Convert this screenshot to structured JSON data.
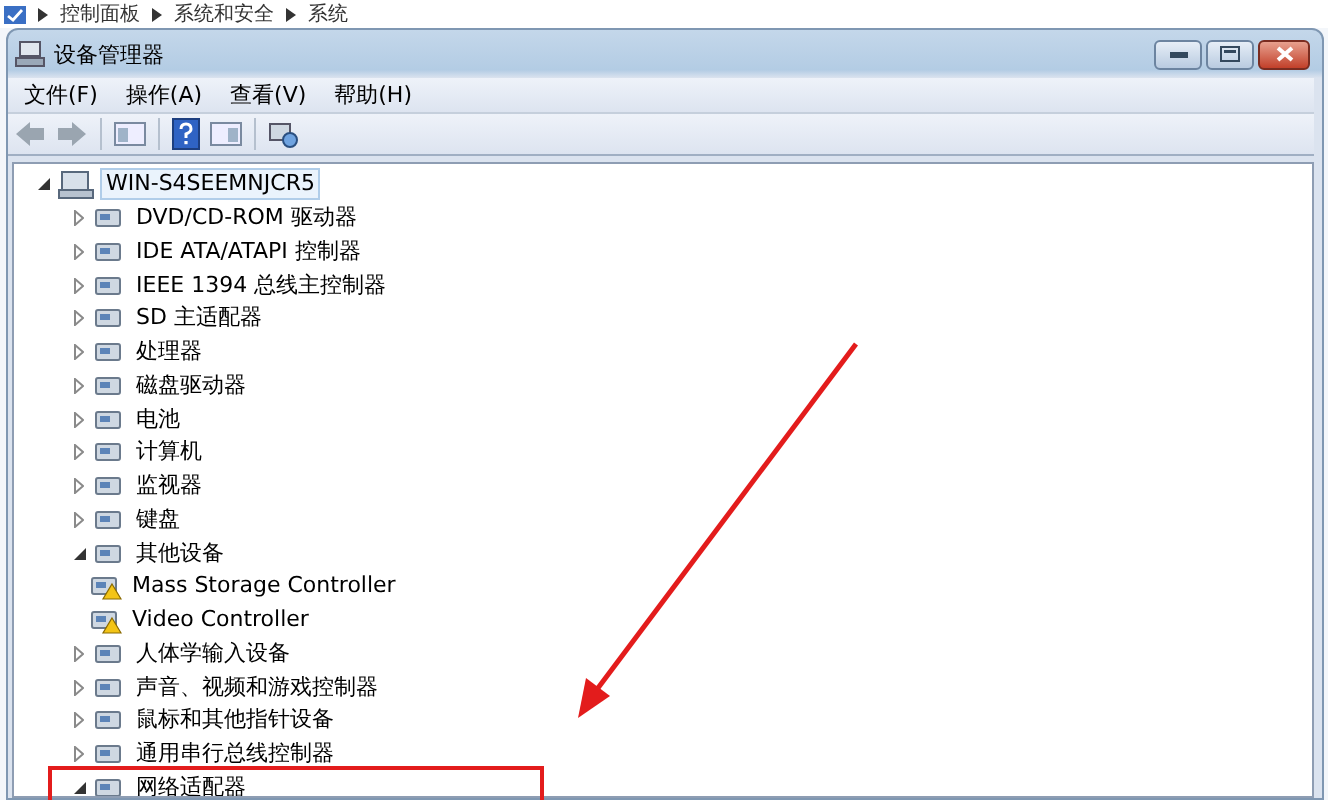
{
  "breadcrumb": [
    "控制面板",
    "系统和安全",
    "系统"
  ],
  "window": {
    "title": "设备管理器"
  },
  "menu": [
    "文件(F)",
    "操作(A)",
    "查看(V)",
    "帮助(H)"
  ],
  "tree": {
    "label": "WIN-S4SEEMNJCR5",
    "expanded": true,
    "selected": true,
    "children": [
      {
        "label": "DVD/CD-ROM 驱动器",
        "expanded": false
      },
      {
        "label": "IDE ATA/ATAPI 控制器",
        "expanded": false
      },
      {
        "label": "IEEE 1394 总线主控制器",
        "expanded": false
      },
      {
        "label": "SD 主适配器",
        "expanded": false
      },
      {
        "label": "处理器",
        "expanded": false
      },
      {
        "label": "磁盘驱动器",
        "expanded": false
      },
      {
        "label": "电池",
        "expanded": false
      },
      {
        "label": "计算机",
        "expanded": false
      },
      {
        "label": "监视器",
        "expanded": false
      },
      {
        "label": "键盘",
        "expanded": false
      },
      {
        "label": "其他设备",
        "expanded": true,
        "children": [
          {
            "label": "Mass Storage Controller",
            "warning": true
          },
          {
            "label": "Video Controller",
            "warning": true
          }
        ]
      },
      {
        "label": "人体学输入设备",
        "expanded": false
      },
      {
        "label": "声音、视频和游戏控制器",
        "expanded": false
      },
      {
        "label": "鼠标和其他指针设备",
        "expanded": false
      },
      {
        "label": "通用串行总线控制器",
        "expanded": false
      },
      {
        "label": "网络适配器",
        "expanded": true,
        "highlighted": true
      }
    ]
  }
}
